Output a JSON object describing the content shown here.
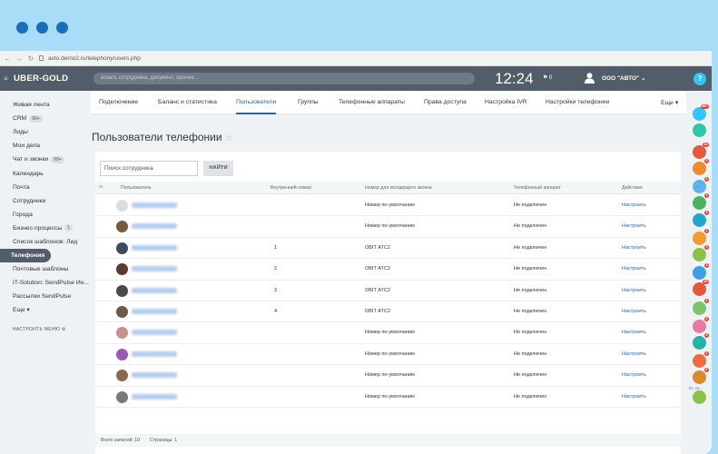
{
  "browser": {
    "url": "avto.demo2.ru/telephony/users.php"
  },
  "header": {
    "logo": "UBER-GOLD",
    "search_placeholder": "искать сотрудника, документ, прочее...",
    "clock": "12:24",
    "flag_count": "0",
    "user_name": "ООО \"АВТО\" ⌄",
    "help": "?"
  },
  "sidebar": {
    "items": [
      {
        "label": "Живая лента"
      },
      {
        "label": "CRM",
        "badge": "99+"
      },
      {
        "label": "Лиды"
      },
      {
        "label": "Мои дела"
      },
      {
        "label": "Чат и звонки",
        "badge": "99+"
      },
      {
        "label": "Календарь"
      },
      {
        "label": "Почта"
      },
      {
        "label": "Сотрудники"
      },
      {
        "label": "Города"
      },
      {
        "label": "Бизнес-процессы",
        "badge": "1"
      },
      {
        "label": "Список шаблонов: Лид"
      },
      {
        "label": "Телефония",
        "active": true
      },
      {
        "label": "Почтовые шаблоны"
      },
      {
        "label": "IT-Solution: SendPulse Ин..."
      },
      {
        "label": "Рассылки SendPulse"
      },
      {
        "label": "Еще ▾"
      }
    ],
    "setup": "НАСТРОИТЬ МЕНЮ ⚙"
  },
  "tabs": [
    {
      "label": "Подключение"
    },
    {
      "label": "Баланс и статистика"
    },
    {
      "label": "Пользователи",
      "active": true
    },
    {
      "label": "Группы"
    },
    {
      "label": "Телефонные аппараты"
    },
    {
      "label": "Права доступа"
    },
    {
      "label": "Настройка IVR"
    },
    {
      "label": "Настройки телефонии"
    },
    {
      "label": "Еще ▾"
    }
  ],
  "page": {
    "title": "Пользователи телефонии",
    "star": "☆"
  },
  "filter": {
    "placeholder": "Поиск сотрудника",
    "button": "НАЙТИ"
  },
  "grid": {
    "columns": [
      "Пользователь",
      "Внутренний номер",
      "Номер для исходящего звонка",
      "Телефонный аппарат",
      "Действия"
    ],
    "rows": [
      {
        "ext": "",
        "outgoing": "Номер по-умолчанию",
        "phone": "Не подключен",
        "action": "Настроить",
        "avatar": "#d9dde2"
      },
      {
        "ext": "",
        "outgoing": "Номер по-умолчанию",
        "phone": "Не подключен",
        "action": "Настроить",
        "avatar": "#7a5a3d"
      },
      {
        "ext": "1",
        "outgoing": "OBIT АТС2",
        "phone": "Не подключен",
        "action": "Настроить",
        "avatar": "#3d4b61"
      },
      {
        "ext": "2",
        "outgoing": "OBIT АТС2",
        "phone": "Не подключен",
        "action": "Настроить",
        "avatar": "#5b3b2c"
      },
      {
        "ext": "3",
        "outgoing": "OBIT АТС2",
        "phone": "Не подключен",
        "action": "Настроить",
        "avatar": "#4a4a4a"
      },
      {
        "ext": "4",
        "outgoing": "OBIT АТС2",
        "phone": "Не подключен",
        "action": "Настроить",
        "avatar": "#6b5a4a"
      },
      {
        "ext": "",
        "outgoing": "Номер по-умолчанию",
        "phone": "Не подключен",
        "action": "Настроить",
        "avatar": "#c98e8e"
      },
      {
        "ext": "",
        "outgoing": "Номер по-умолчанию",
        "phone": "Не подключен",
        "action": "Настроить",
        "avatar": "#9b59b6"
      },
      {
        "ext": "",
        "outgoing": "Номер по-умолчанию",
        "phone": "Не подключен",
        "action": "Настроить",
        "avatar": "#8a6a4a"
      },
      {
        "ext": "",
        "outgoing": "Номер по-умолчанию",
        "phone": "Не подключен",
        "action": "Настроить",
        "avatar": "#7a7a7a"
      }
    ],
    "footer": {
      "total": "Всего записей: 10",
      "pages": "Страницы: 1"
    }
  },
  "rightbar": {
    "items": [
      {
        "color": "#2fc7f7",
        "badge": "99+"
      },
      {
        "color": "#2fc7a5"
      },
      {
        "color": "#e25a3a",
        "badge": "12"
      },
      {
        "color": "#f08a2c",
        "badge": "1"
      },
      {
        "color": "#5ab5e8",
        "badge": "1"
      },
      {
        "color": "#4bb35f",
        "badge": "1"
      },
      {
        "color": "#21a7c7",
        "badge": "1"
      },
      {
        "color": "#f29b30",
        "badge": "1"
      },
      {
        "color": "#8bc34a",
        "badge": "1"
      },
      {
        "color": "#3f9ee8",
        "badge": "1"
      },
      {
        "color": "#e5573c",
        "badge": "15"
      },
      {
        "color": "#7ec36b",
        "badge": "1"
      },
      {
        "color": "#e67aa0",
        "badge": "1"
      },
      {
        "color": "#21b5a4",
        "badge": "1"
      },
      {
        "color": "#f06a40",
        "badge": "1"
      },
      {
        "color": "#d98b2a",
        "badge": "1"
      },
      {
        "color": "#8bc34a"
      }
    ],
    "label": "Вс 28..."
  },
  "colors": {
    "accent": "#2067b0",
    "header_bg": "#535c69",
    "frame": "#a9dcf7"
  }
}
